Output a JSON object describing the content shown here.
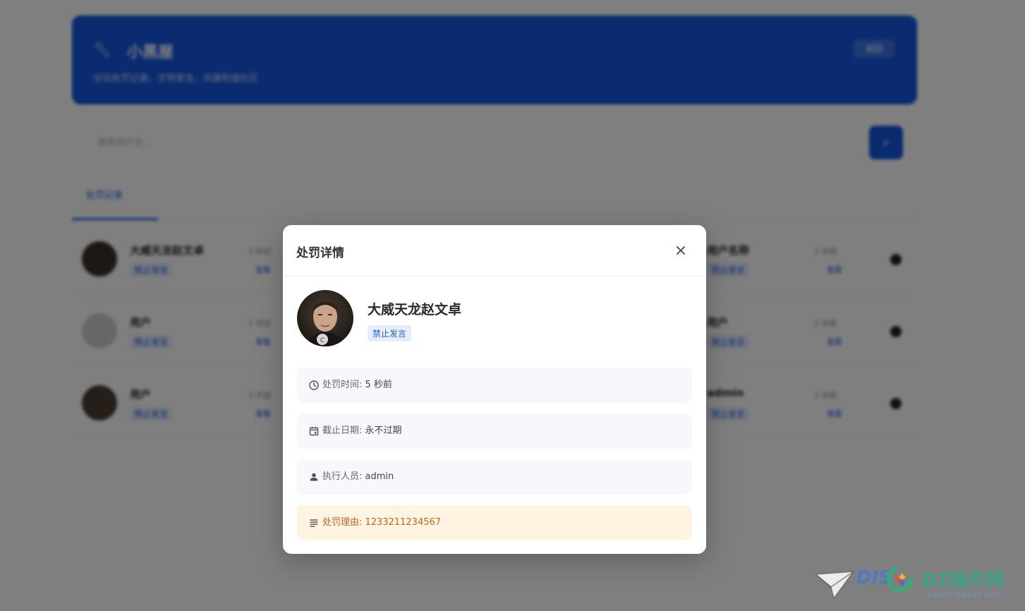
{
  "background": {
    "banner": {
      "title": "小黑屋",
      "subtitle": "论坛处罚记录，文明发言，共建和谐社区",
      "button_label": "返回"
    },
    "search": {
      "placeholder": "搜索用户名..."
    },
    "tab": {
      "label": "处罚记录"
    },
    "rows": [
      {
        "left_name": "大威天龙赵文卓",
        "left_tag": "禁止发言",
        "left_time": "5 秒前",
        "left_action": "查看",
        "right_name": "用户名称",
        "right_tag": "禁止发言",
        "right_time": "1 天前",
        "right_action": "查看"
      },
      {
        "left_name": "用户",
        "left_tag": "禁止发言",
        "left_time": "2 天前",
        "left_action": "查看",
        "right_name": "用户",
        "right_tag": "禁止发言",
        "right_time": "2 天前",
        "right_action": "查看"
      },
      {
        "left_name": "用户",
        "left_tag": "禁止发言",
        "left_time": "3 天前",
        "left_action": "查看",
        "right_name": "admin",
        "right_tag": "禁止发言",
        "right_time": "3 天前",
        "right_action": "查看"
      }
    ]
  },
  "modal": {
    "title": "处罚详情",
    "user": {
      "name": "大威天龙赵文卓",
      "badge": "禁止发言"
    },
    "details": [
      {
        "icon": "clock-icon",
        "label": "处罚时间: ",
        "value": "5 秒前"
      },
      {
        "icon": "calendar-icon",
        "label": "截止日期: ",
        "value": "永不过期"
      },
      {
        "icon": "person-icon",
        "label": "执行人员: ",
        "value": "admin"
      },
      {
        "icon": "text-lines-icon",
        "label": "处罚理由: ",
        "value": "1233211234567"
      }
    ]
  },
  "watermark": {
    "brand_left": "DIS",
    "brand_right": "DZ插件网",
    "url": "addon.dismall.com"
  },
  "colors": {
    "primary": "#1456e0",
    "overlay": "rgba(0,0,0,0.5)",
    "reason_bg": "#fff3e2",
    "reason_text": "#c7661c",
    "badge_bg": "#e7eefb",
    "badge_text": "#2563c9"
  }
}
